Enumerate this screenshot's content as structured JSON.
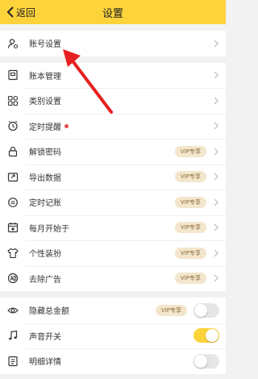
{
  "header": {
    "back_label": "返回",
    "title": "设置",
    "bg_color": "#fcd33a"
  },
  "groups": [
    {
      "items": [
        {
          "label": "账号设置",
          "icon": "user-gear-icon"
        }
      ]
    },
    {
      "items": [
        {
          "label": "账本管理",
          "icon": "book-icon"
        },
        {
          "label": "类别设置",
          "icon": "grid-icon"
        },
        {
          "label": "定时提醒",
          "icon": "alarm-icon",
          "dot": true
        },
        {
          "label": "解锁密码",
          "icon": "lock-icon",
          "vip": "VIP专享"
        },
        {
          "label": "导出数据",
          "icon": "export-icon",
          "vip": "VIP专享"
        },
        {
          "label": "定时记账",
          "icon": "timer-icon",
          "vip": "VIP专享"
        },
        {
          "label": "每月开始于",
          "icon": "calendar-icon",
          "vip": "VIP专享"
        },
        {
          "label": "个性装扮",
          "icon": "shirt-icon",
          "vip": "VIP专享"
        },
        {
          "label": "去除广告",
          "icon": "no-ad-icon",
          "vip": "VIP专享"
        }
      ]
    },
    {
      "items": [
        {
          "label": "隐藏总金额",
          "icon": "eye-icon",
          "vip": "VIP专享",
          "toggle": false
        },
        {
          "label": "声音开关",
          "icon": "music-icon",
          "toggle": true
        },
        {
          "label": "明细详情",
          "icon": "list-icon",
          "toggle": false
        }
      ]
    }
  ],
  "colors": {
    "accent": "#fcd33a",
    "vip_bg": "#f3e6cc",
    "vip_text": "#8a6b3b",
    "dot": "#e44b4b",
    "annotation_arrow": "#e62020"
  }
}
